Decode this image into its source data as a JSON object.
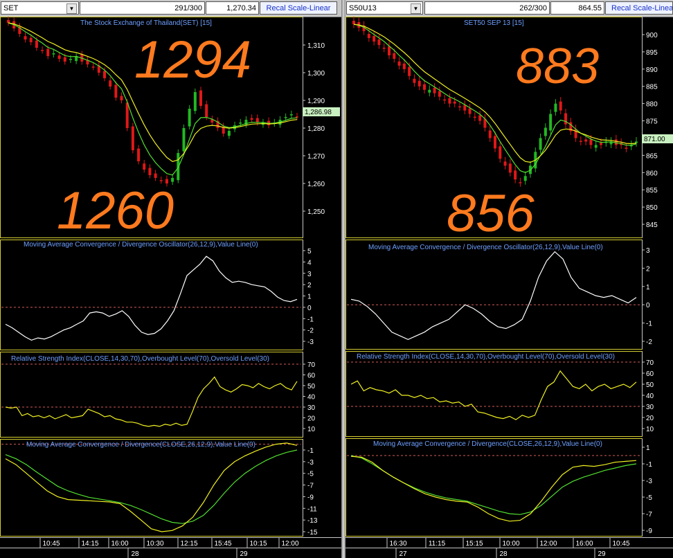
{
  "left": {
    "symbol": "SET",
    "counter": "291/300",
    "last_price": "1,270.34",
    "recal_label": "Recal Scale-Linear",
    "chart_title": "The Stock Exchange of Thailand(SET) [15]",
    "price_label": "1,286.98",
    "annotation_high": "1294",
    "annotation_low": "1260",
    "price_axis": [
      "1,310",
      "1,300",
      "1,290",
      "1,280",
      "1,270",
      "1,260",
      "1,250"
    ],
    "macd_osc_title": "Moving Average Convergence / Divergence Oscillator(26,12,9),Value Line(0)",
    "macd_osc_axis": [
      "5",
      "4",
      "3",
      "2",
      "1",
      "0",
      "-1",
      "-2",
      "-3"
    ],
    "rsi_title": "Relative Strength Index(CLOSE,14,30,70),Overbought Level(70),Oversold Level(30)",
    "rsi_axis": [
      "70",
      "60",
      "50",
      "40",
      "30",
      "20",
      "10"
    ],
    "macd_title": "Moving Average Convergence / Divergence(CLOSE,26,12,9),Value Line(0)",
    "macd_axis": [
      "-1",
      "-3",
      "-5",
      "-7",
      "-9",
      "-11",
      "-13",
      "-15"
    ],
    "time_labels": [
      "10:45",
      "14:15",
      "16:00",
      "10:30",
      "12:15",
      "15:45",
      "10:15",
      "12:00"
    ],
    "day_labels": [
      "28",
      "29"
    ]
  },
  "right": {
    "symbol": "S50U13",
    "counter": "262/300",
    "last_price": "864.55",
    "recal_label": "Recal Scale-Linear",
    "chart_title": "SET50 SEP 13   [15]",
    "price_label": "871.00",
    "annotation_high": "883",
    "annotation_low": "856",
    "price_axis": [
      "900",
      "895",
      "890",
      "885",
      "880",
      "875",
      "870",
      "865",
      "860",
      "855",
      "850",
      "845"
    ],
    "macd_osc_title": "Moving Average Convergence / Divergence Oscillator(26,12,9),Value Line(0)",
    "macd_osc_axis": [
      "3",
      "2",
      "1",
      "0",
      "-1",
      "-2"
    ],
    "rsi_title": "Relative Strength Index(CLOSE,14,30,70),Overbought Level(70),Oversold Level(30)",
    "rsi_axis": [
      "70",
      "60",
      "50",
      "40",
      "30",
      "20",
      "10"
    ],
    "macd_title": "Moving Average Convergence / Divergence(CLOSE,26,12,9),Value Line(0)",
    "macd_axis": [
      "1",
      "-1",
      "-3",
      "-5",
      "-7",
      "-9"
    ],
    "time_labels": [
      "16:30",
      "11:15",
      "15:15",
      "10:00",
      "12:00",
      "16:00",
      "10:45"
    ],
    "day_labels": [
      "27",
      "28",
      "29"
    ]
  },
  "colors": {
    "up": "#22b822",
    "down": "#e01818",
    "ema_fast": "#52e030",
    "ema_slow": "#f0f020",
    "annotation": "#ff7a1e",
    "title": "#6ea0ff",
    "ref_line": "#d85a5a",
    "panel_border": "#d8d030",
    "price_tag": "#c8f0c0"
  },
  "chart_data": [
    {
      "type": "candlestick",
      "title": "The Stock Exchange of Thailand(SET) [15]",
      "ylim": [
        1244,
        1326
      ],
      "series": [
        {
          "name": "close",
          "values": [
            1318,
            1316,
            1314,
            1312,
            1311,
            1309,
            1308,
            1306,
            1307,
            1305,
            1304,
            1305,
            1306,
            1304,
            1303,
            1302,
            1300,
            1298,
            1295,
            1291,
            1290,
            1280,
            1272,
            1268,
            1265,
            1263,
            1262,
            1261,
            1260,
            1262,
            1271,
            1280,
            1287,
            1293,
            1288,
            1284,
            1282,
            1280,
            1278,
            1279,
            1281,
            1282,
            1283,
            1283,
            1282,
            1282,
            1281,
            1282,
            1283,
            1284,
            1285,
            1284
          ]
        }
      ]
    },
    {
      "type": "line",
      "title": "Moving Average Convergence / Divergence Oscillator(26,12,9),Value Line(0)",
      "ylim": [
        -3.4,
        5.2
      ],
      "series": [
        {
          "name": "oscillator",
          "values": [
            -1.5,
            -1.8,
            -2.2,
            -2.6,
            -2.9,
            -2.7,
            -2.8,
            -2.6,
            -2.3,
            -2.0,
            -1.8,
            -1.5,
            -1.2,
            -0.5,
            -0.4,
            -0.5,
            -0.8,
            -0.6,
            -0.3,
            -0.8,
            -1.6,
            -2.2,
            -2.4,
            -2.3,
            -1.9,
            -1.2,
            -0.3,
            1.2,
            2.8,
            3.3,
            3.8,
            4.5,
            4.1,
            3.2,
            2.6,
            2.2,
            2.3,
            2.2,
            2.0,
            1.9,
            1.8,
            1.4,
            0.9,
            0.6,
            0.5,
            0.7
          ]
        }
      ]
    },
    {
      "type": "line",
      "title": "Relative Strength Index(CLOSE,14,30,70),Overbought Level(70),Oversold Level(30)",
      "ylim": [
        5,
        75
      ],
      "series": [
        {
          "name": "rsi",
          "values": [
            30,
            29,
            30,
            22,
            24,
            21,
            22,
            20,
            22,
            19,
            21,
            23,
            20,
            21,
            22,
            28,
            26,
            24,
            21,
            22,
            19,
            18,
            16,
            16,
            15,
            13,
            12,
            13,
            12,
            14,
            13,
            15,
            13,
            14,
            26,
            39,
            47,
            52,
            58,
            49,
            46,
            44,
            47,
            51,
            50,
            48,
            52,
            49,
            47,
            50,
            52,
            48,
            46,
            54
          ]
        }
      ]
    },
    {
      "type": "line",
      "title": "Moving Average Convergence / Divergence(CLOSE,26,12,9),Value Line(0)",
      "ylim": [
        -16,
        0
      ],
      "series": [
        {
          "name": "macd",
          "values": [
            -2.5,
            -3.5,
            -5,
            -6.5,
            -8,
            -9,
            -9.5,
            -9.6,
            -9.7,
            -9.8,
            -9.9,
            -10.2,
            -11.5,
            -13,
            -14.5,
            -15,
            -14.8,
            -14,
            -12.5,
            -10,
            -7,
            -4.5,
            -3,
            -2,
            -1.2,
            -0.5,
            0,
            0.2,
            -0.2
          ]
        },
        {
          "name": "signal",
          "values": [
            -1.8,
            -2.5,
            -3.5,
            -4.8,
            -6,
            -7.2,
            -8,
            -8.6,
            -9.1,
            -9.4,
            -9.7,
            -10,
            -10.5,
            -11.2,
            -12,
            -12.8,
            -13.4,
            -13.6,
            -13.2,
            -12.2,
            -10.5,
            -8.4,
            -6.5,
            -5,
            -3.8,
            -2.8,
            -2,
            -1.4,
            -1
          ]
        }
      ]
    },
    {
      "type": "candlestick",
      "title": "SET50 SEP 13   [15]",
      "ylim": [
        840,
        905
      ],
      "series": [
        {
          "name": "close",
          "values": [
            903,
            902,
            901,
            899,
            898,
            897,
            896,
            894,
            893,
            891,
            890,
            888,
            886,
            885,
            884,
            884,
            883,
            882,
            881,
            880,
            880,
            879,
            878,
            877,
            876,
            875,
            873,
            870,
            867,
            864,
            862,
            860,
            858,
            857,
            859,
            862,
            866,
            870,
            873,
            877,
            880,
            878,
            874,
            872,
            870,
            869,
            869,
            868,
            868,
            868,
            869,
            869,
            868,
            868,
            867,
            868,
            869
          ]
        }
      ]
    },
    {
      "type": "line",
      "title": "Moving Average Convergence / Divergence Oscillator(26,12,9),Value Line(0)",
      "ylim": [
        -2.4,
        3.4
      ],
      "series": [
        {
          "name": "oscillator",
          "values": [
            0.3,
            0.2,
            -0.1,
            -0.5,
            -1.0,
            -1.5,
            -1.7,
            -1.9,
            -1.7,
            -1.5,
            -1.2,
            -1.0,
            -0.8,
            -0.4,
            0,
            -0.2,
            -0.5,
            -0.9,
            -1.2,
            -1.3,
            -1.1,
            -0.8,
            0.2,
            1.5,
            2.4,
            2.9,
            2.5,
            1.5,
            0.9,
            0.7,
            0.5,
            0.4,
            0.5,
            0.3,
            0.1,
            0.4
          ]
        }
      ]
    },
    {
      "type": "line",
      "title": "Relative Strength Index(CLOSE,14,30,70),Overbought Level(70),Oversold Level(30)",
      "ylim": [
        5,
        75
      ],
      "series": [
        {
          "name": "rsi",
          "values": [
            50,
            53,
            44,
            47,
            45,
            44,
            42,
            45,
            40,
            40,
            38,
            40,
            37,
            38,
            34,
            35,
            33,
            34,
            30,
            32,
            25,
            24,
            22,
            20,
            19,
            21,
            18,
            22,
            20,
            22,
            36,
            48,
            52,
            62,
            55,
            48,
            46,
            50,
            44,
            48,
            50,
            46,
            48,
            50,
            47,
            52
          ]
        }
      ]
    },
    {
      "type": "line",
      "title": "Moving Average Convergence / Divergence(CLOSE,26,12,9),Value Line(0)",
      "ylim": [
        -9.5,
        1.6
      ],
      "series": [
        {
          "name": "macd",
          "values": [
            -0.1,
            -0.2,
            -0.8,
            -1.8,
            -2.6,
            -3.3,
            -4.0,
            -4.6,
            -5.0,
            -5.3,
            -5.5,
            -5.6,
            -6.2,
            -7.0,
            -7.6,
            -7.9,
            -7.8,
            -7.0,
            -5.5,
            -3.8,
            -2.3,
            -1.4,
            -1.2,
            -1.3,
            -1.1,
            -0.8,
            -0.7,
            -0.6
          ]
        },
        {
          "name": "signal",
          "values": [
            0,
            -0.3,
            -1.0,
            -1.8,
            -2.6,
            -3.3,
            -3.9,
            -4.4,
            -4.8,
            -5.1,
            -5.3,
            -5.5,
            -5.9,
            -6.3,
            -6.7,
            -7.0,
            -7.1,
            -6.8,
            -6.0,
            -4.9,
            -3.8,
            -3.1,
            -2.6,
            -2.2,
            -1.8,
            -1.5,
            -1.2,
            -1.0
          ]
        }
      ]
    }
  ]
}
